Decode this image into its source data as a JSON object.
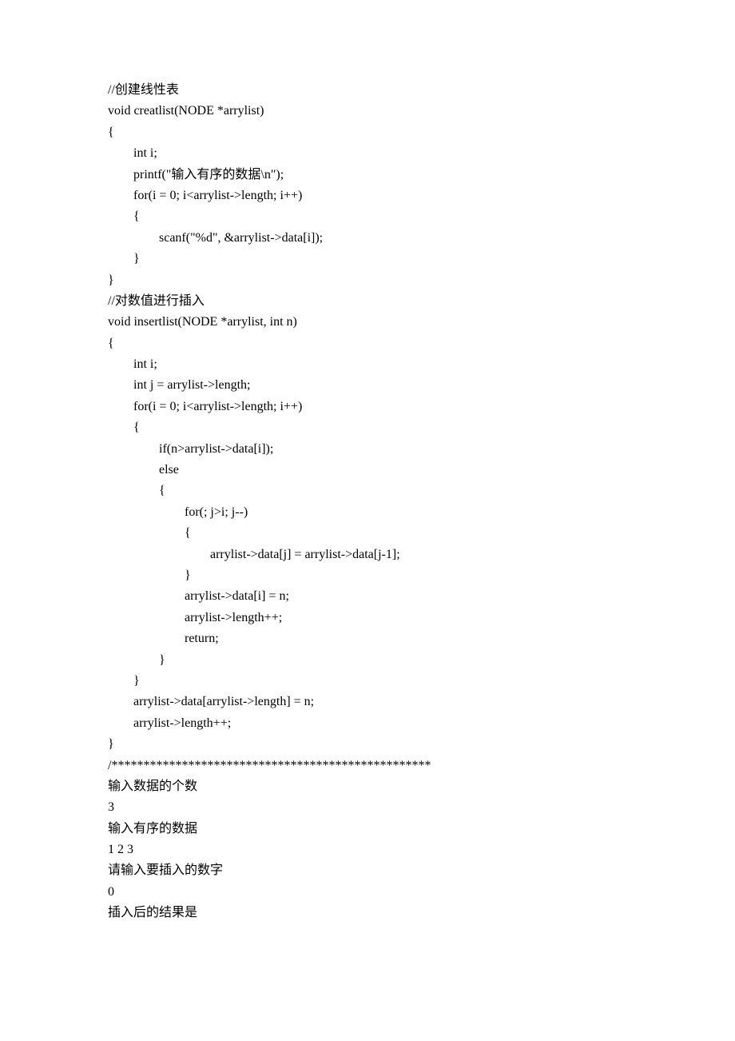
{
  "lines": [
    "//创建线性表",
    "void creatlist(NODE *arrylist)",
    "{",
    "        int i;",
    "",
    "        printf(\"输入有序的数据\\n\");",
    "        for(i = 0; i<arrylist->length; i++)",
    "        {",
    "                scanf(\"%d\", &arrylist->data[i]);",
    "        }",
    "}",
    "",
    "//对数值进行插入",
    "void insertlist(NODE *arrylist, int n)",
    "{",
    "        int i;",
    "        int j = arrylist->length;",
    "",
    "        for(i = 0; i<arrylist->length; i++)",
    "        {",
    "                if(n>arrylist->data[i]);",
    "                else",
    "                {",
    "                        for(; j>i; j--)",
    "                        {",
    "                                arrylist->data[j] = arrylist->data[j-1];",
    "                        }",
    "                        arrylist->data[i] = n;",
    "                        arrylist->length++;",
    "                        return;",
    "                }",
    "",
    "        }",
    "        arrylist->data[arrylist->length] = n;",
    "        arrylist->length++;",
    "}",
    "/**************************************************",
    "输入数据的个数",
    "3",
    "输入有序的数据",
    "1 2 3",
    "请输入要插入的数字",
    "0",
    "插入后的结果是"
  ]
}
